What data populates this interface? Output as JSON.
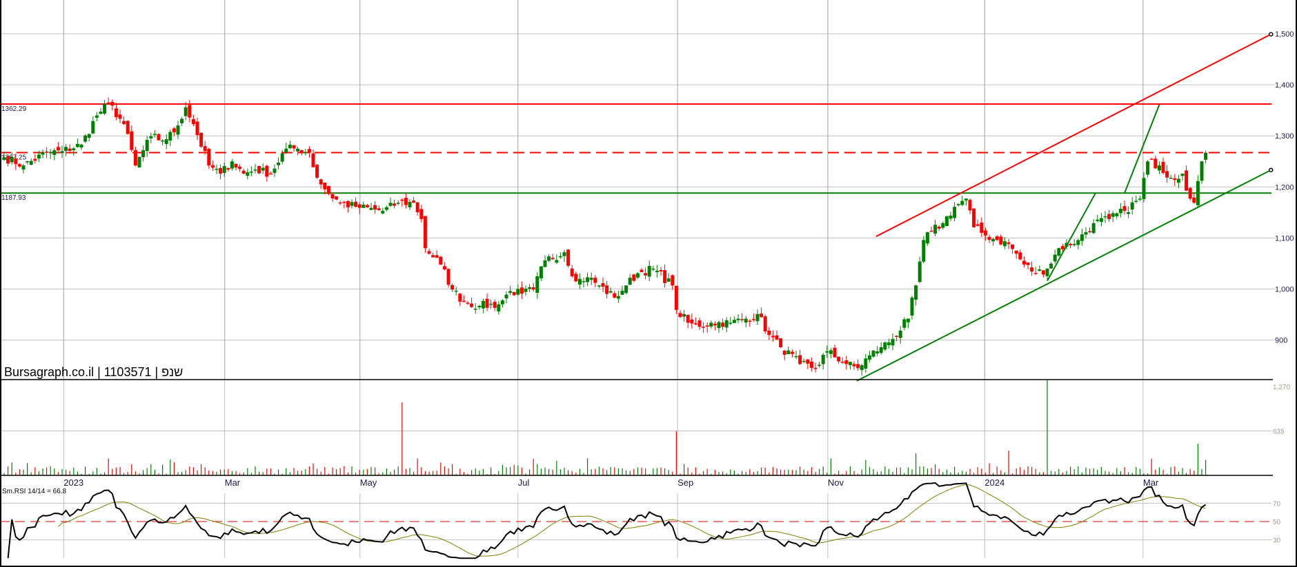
{
  "chart_data": {
    "type": "candlestick",
    "title": "Bursagraph.co.il | 1103571 | שנפ",
    "price_axis": {
      "ticks": [
        900,
        1000,
        1100,
        1200,
        1300,
        1400,
        1500
      ],
      "tick_labels": [
        "900",
        "1,000",
        "1,100",
        "1,200",
        "1,300",
        "1,400",
        "1,500"
      ],
      "ylim": [
        820,
        1570
      ]
    },
    "x_axis": {
      "ticks": [
        {
          "label": "2023",
          "index": 15.4
        },
        {
          "label": "Mar",
          "index": 57.1
        },
        {
          "label": "May",
          "index": 92.1
        },
        {
          "label": "Jul",
          "index": 133
        },
        {
          "label": "Sep",
          "index": 174.3
        },
        {
          "label": "Nov",
          "index": 213.2
        },
        {
          "label": "2024",
          "index": 253.8
        },
        {
          "label": "Mar",
          "index": 294.8
        }
      ],
      "xlim": [
        -1,
        329
      ]
    },
    "close_anchors": [
      [
        0,
        1258
      ],
      [
        5,
        1242
      ],
      [
        11,
        1267
      ],
      [
        15,
        1270
      ],
      [
        20,
        1283
      ],
      [
        24,
        1340
      ],
      [
        27,
        1364
      ],
      [
        31,
        1323
      ],
      [
        34,
        1242
      ],
      [
        38,
        1299
      ],
      [
        41,
        1291
      ],
      [
        44,
        1307
      ],
      [
        47,
        1356
      ],
      [
        49,
        1323
      ],
      [
        53,
        1242
      ],
      [
        56,
        1226
      ],
      [
        59,
        1250
      ],
      [
        62,
        1226
      ],
      [
        65,
        1234
      ],
      [
        69,
        1226
      ],
      [
        73,
        1275
      ],
      [
        76,
        1275
      ],
      [
        79,
        1267
      ],
      [
        81,
        1218
      ],
      [
        84,
        1186
      ],
      [
        87,
        1169
      ],
      [
        91,
        1161
      ],
      [
        98,
        1153
      ],
      [
        102,
        1169
      ],
      [
        106,
        1169
      ],
      [
        108,
        1137
      ],
      [
        109,
        1080
      ],
      [
        113,
        1048
      ],
      [
        116,
        999
      ],
      [
        119,
        975
      ],
      [
        123,
        967
      ],
      [
        128,
        970
      ],
      [
        131,
        996
      ],
      [
        134,
        991
      ],
      [
        137,
        999
      ],
      [
        140,
        1056
      ],
      [
        145,
        1072
      ],
      [
        148,
        1015
      ],
      [
        151,
        1023
      ],
      [
        154,
        1007
      ],
      [
        158,
        983
      ],
      [
        161,
        1007
      ],
      [
        164,
        1031
      ],
      [
        168,
        1040
      ],
      [
        173,
        1007
      ],
      [
        174,
        959
      ],
      [
        177,
        934
      ],
      [
        180,
        926
      ],
      [
        183,
        934
      ],
      [
        188,
        934
      ],
      [
        192,
        942
      ],
      [
        195,
        951
      ],
      [
        198,
        910
      ],
      [
        201,
        886
      ],
      [
        206,
        853
      ],
      [
        210,
        845
      ],
      [
        213,
        878
      ],
      [
        218,
        853
      ],
      [
        221,
        845
      ],
      [
        224,
        870
      ],
      [
        227,
        886
      ],
      [
        230,
        902
      ],
      [
        234,
        942
      ],
      [
        236,
        1007
      ],
      [
        238,
        1096
      ],
      [
        240,
        1113
      ],
      [
        243,
        1129
      ],
      [
        246,
        1161
      ],
      [
        249,
        1177
      ],
      [
        251,
        1121
      ],
      [
        254,
        1105
      ],
      [
        257,
        1096
      ],
      [
        260,
        1088
      ],
      [
        264,
        1048
      ],
      [
        267,
        1031
      ],
      [
        270,
        1040
      ],
      [
        273,
        1080
      ],
      [
        278,
        1096
      ],
      [
        282,
        1129
      ],
      [
        286,
        1137
      ],
      [
        290,
        1153
      ],
      [
        294,
        1177
      ],
      [
        296,
        1250
      ],
      [
        299,
        1242
      ],
      [
        302,
        1218
      ],
      [
        305,
        1226
      ],
      [
        307,
        1177
      ],
      [
        308,
        1169
      ],
      [
        310,
        1250
      ],
      [
        311,
        1267
      ]
    ],
    "levels": [
      {
        "label": "1362.29",
        "value": 1362.29,
        "color": "#ff0000",
        "style": "solid"
      },
      {
        "label": "1267.25",
        "value": 1267.25,
        "color": "#ff0000",
        "style": "dashed"
      },
      {
        "label": "1187.93",
        "value": 1187.93,
        "color": "#008000",
        "style": "solid"
      }
    ],
    "trendlines": [
      {
        "color": "#ff0000",
        "from": [
          225.7,
          1103
        ],
        "to": [
          327.9,
          1499
        ],
        "end_marker": true
      },
      {
        "color": "#008000",
        "from": [
          220.7,
          820
        ],
        "to": [
          327.9,
          1233
        ],
        "end_marker": true
      },
      {
        "color": "#008000",
        "from": [
          270,
          1016
        ],
        "to": [
          282.5,
          1188
        ],
        "end_marker": false
      },
      {
        "color": "#008000",
        "from": [
          290,
          1188
        ],
        "to": [
          299,
          1361
        ],
        "end_marker": false
      }
    ],
    "volume": {
      "ticks": [
        "1,270",
        "635"
      ],
      "tick_values": [
        1270,
        635
      ],
      "spikes": [
        [
          103,
          1043
        ],
        [
          174,
          630
        ],
        [
          236,
          315
        ],
        [
          260,
          354
        ],
        [
          270,
          1358
        ],
        [
          309,
          453
        ]
      ]
    },
    "rsi": {
      "label": "Sm.RSI 14/14 = 66.8",
      "period": 14,
      "signal_period": 14,
      "levels": [
        30,
        50,
        70
      ],
      "level_labels": [
        "30",
        "50",
        "70"
      ],
      "ylim": [
        10,
        95
      ]
    },
    "colors": {
      "up": "#008000",
      "down": "#ff0000",
      "rsi": "#000000",
      "signal": "#808000",
      "grid": "#c0c0c0"
    }
  }
}
